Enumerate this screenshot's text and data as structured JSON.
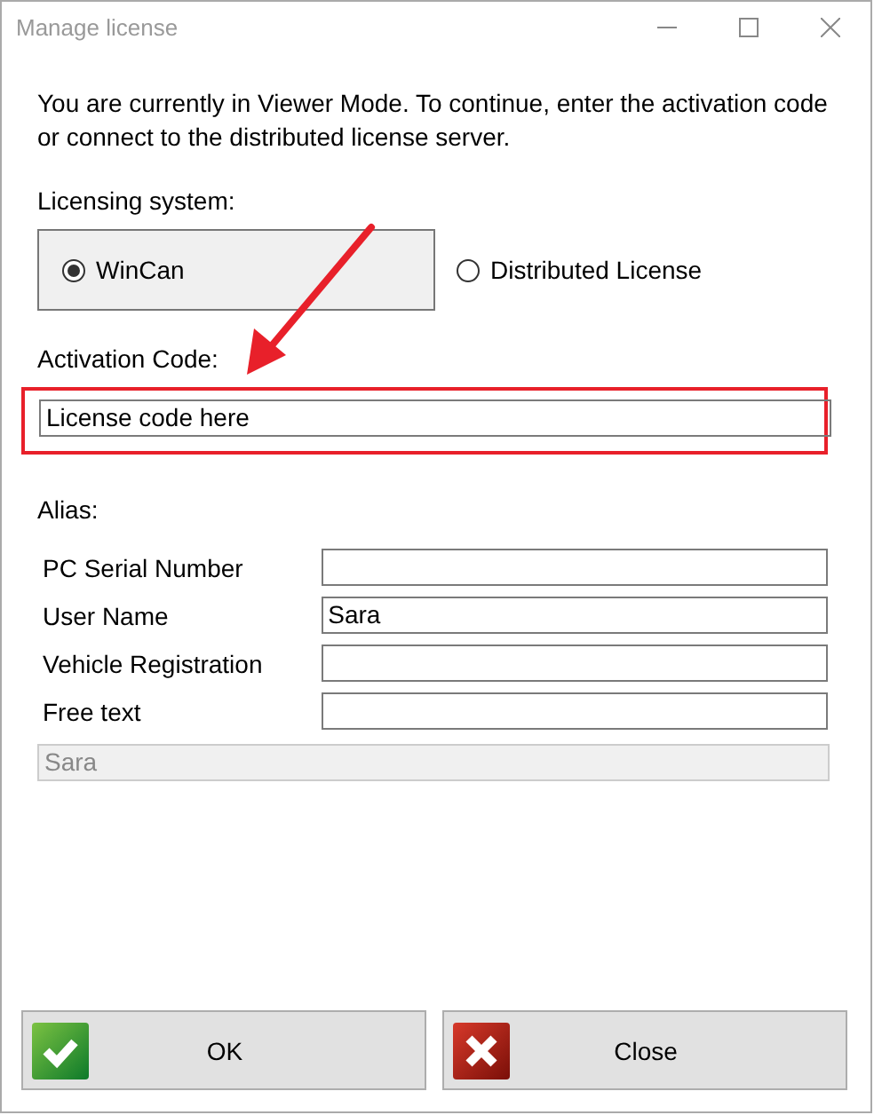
{
  "window": {
    "title": "Manage license"
  },
  "message": "You are currently in Viewer Mode. To continue, enter the activation code or connect to the distributed license server.",
  "licensing_system": {
    "label": "Licensing system:",
    "options": [
      {
        "label": "WinCan",
        "selected": true
      },
      {
        "label": "Distributed License",
        "selected": false
      }
    ]
  },
  "activation_code": {
    "label": "Activation Code:",
    "value": "License code here",
    "highlighted": true
  },
  "alias": {
    "label": "Alias:",
    "fields": [
      {
        "label": "PC Serial Number"
      },
      {
        "label": "User Name",
        "value": "Sara"
      },
      {
        "label": "Vehicle Registration"
      },
      {
        "label": "Free text"
      }
    ],
    "preview": "Sara"
  },
  "buttons": [
    {
      "label": "OK",
      "kind": "ok"
    },
    {
      "label": "Close",
      "kind": "close"
    }
  ]
}
